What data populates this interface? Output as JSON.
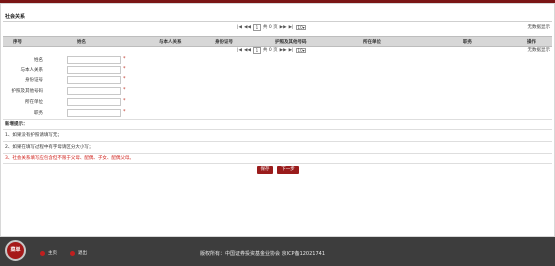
{
  "section": {
    "title": "社会关系"
  },
  "pager": {
    "first": "|◀",
    "prev": "◀◀",
    "page": "1",
    "total": "共 0 页",
    "next": "▶▶",
    "last": "▶|",
    "per_page": "10"
  },
  "no_records": "无数据显示",
  "table": {
    "headers": [
      "序号",
      "姓名",
      "与本人关系",
      "身份证号",
      "护照及其他号码",
      "所在单位",
      "职务",
      "操作"
    ]
  },
  "form": {
    "fields": [
      {
        "label": "姓名",
        "required": "*"
      },
      {
        "label": "与本人关系",
        "required": "*"
      },
      {
        "label": "身份证号",
        "required": "*"
      },
      {
        "label": "护照及其他号码",
        "required": "*"
      },
      {
        "label": "所在单位",
        "required": "*"
      },
      {
        "label": "职务",
        "required": "*"
      }
    ]
  },
  "tips": {
    "title": "新增提示：",
    "items": [
      "1、如果没有护照请填写无；",
      "2、如果在填写过程中有字母请区分大小写；",
      "3、社会关系填写应包含但不限于父母、配偶、子女、配偶父母。"
    ]
  },
  "buttons": {
    "save": "保存",
    "next": "下一步"
  },
  "footer": {
    "menu": "菜单",
    "home": "主页",
    "logout": "退出",
    "copyright": "版权所有：中国证券投资基金业协会 京ICP备12021741"
  }
}
